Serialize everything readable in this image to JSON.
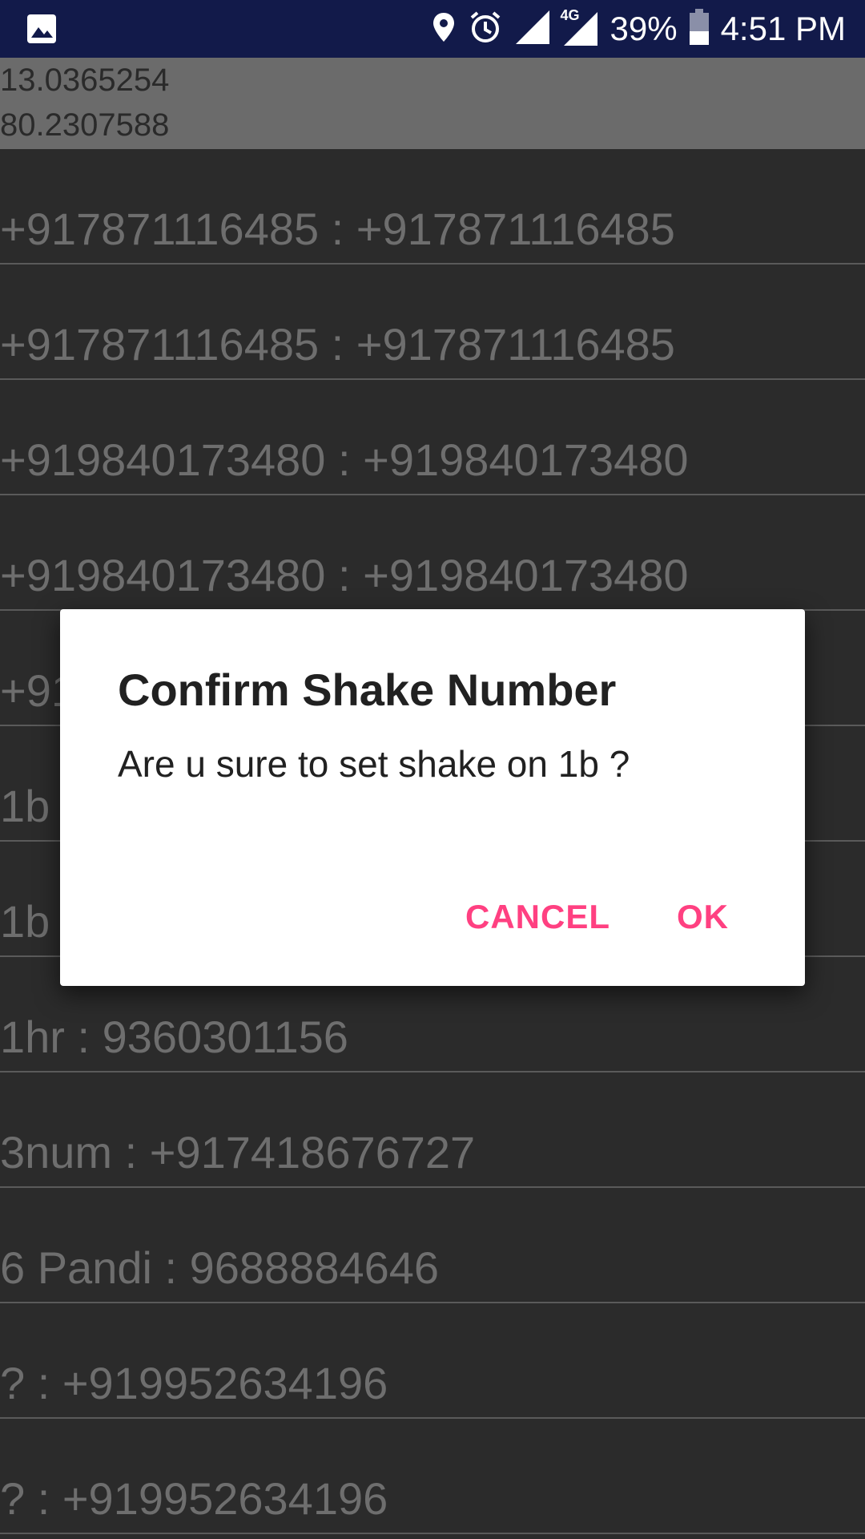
{
  "status_bar": {
    "battery": "39%",
    "time": "4:51 PM",
    "network": "4G"
  },
  "coordinates": {
    "latitude": "13.0365254",
    "longitude": "80.2307588"
  },
  "list": {
    "items": [
      "+917871116485 : +917871116485",
      "+917871116485 : +917871116485",
      "+919840173480 : +919840173480",
      "+919840173480 : +919840173480",
      "+91",
      "1b",
      "1b",
      "1hr : 9360301156",
      "3num : +917418676727",
      "6 Pandi : 9688884646",
      "? : +919952634196",
      "? : +919952634196"
    ]
  },
  "dialog": {
    "title": "Confirm Shake Number",
    "message": "Are u sure to set shake on 1b  ?",
    "cancel_label": "CANCEL",
    "ok_label": "OK"
  },
  "colors": {
    "status_bar": "#121a4a",
    "background": "#2b2b2b",
    "accent": "#ff4081"
  },
  "icons": [
    "gallery-icon",
    "location-icon",
    "alarm-icon",
    "signal-icon",
    "battery-icon"
  ]
}
